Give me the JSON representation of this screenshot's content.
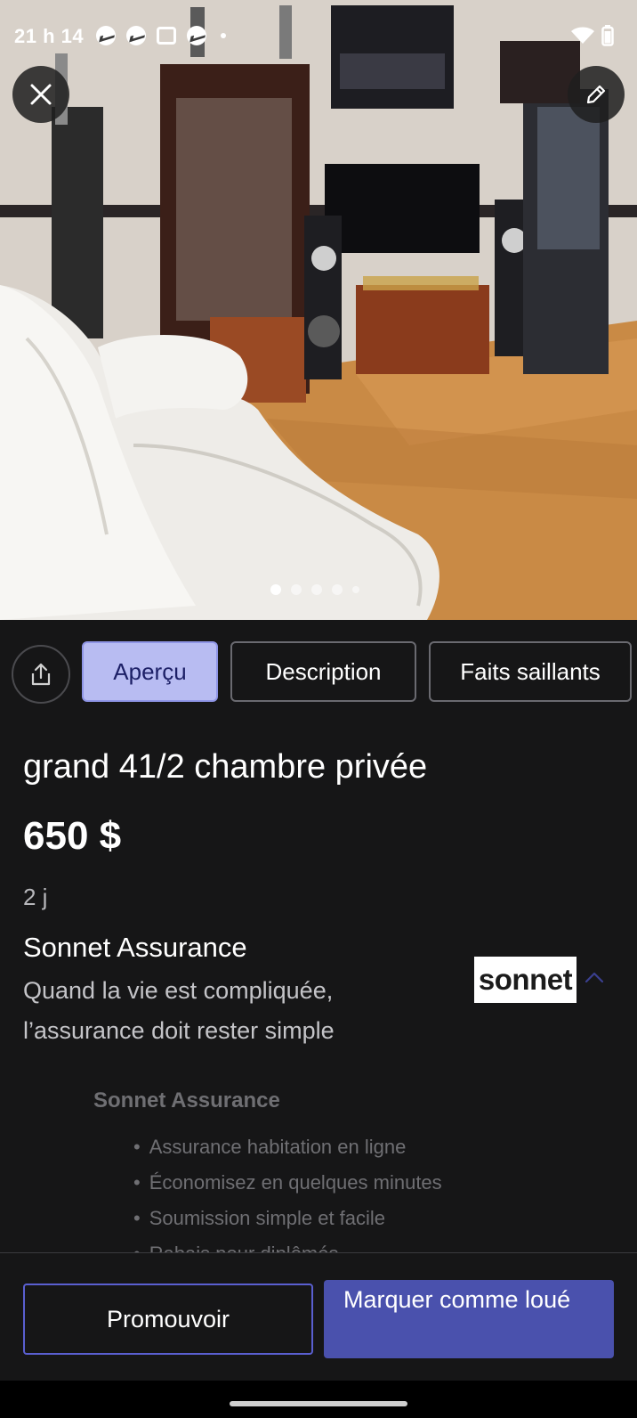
{
  "status_bar": {
    "time": "21 h 14",
    "icons": [
      "messenger-icon",
      "messenger-icon",
      "notification-icon",
      "messenger-icon",
      "dot-icon",
      "wifi-icon",
      "battery-icon"
    ]
  },
  "photo": {
    "current_index": 1,
    "total": 5
  },
  "tabs": [
    {
      "label": "Aperçu",
      "selected": true
    },
    {
      "label": "Description",
      "selected": false
    },
    {
      "label": "Faits saillants",
      "selected": false
    }
  ],
  "listing": {
    "title": "grand 41/2 chambre privée",
    "price": "650 $",
    "age": "2 j"
  },
  "ad": {
    "title": "Sonnet Assurance",
    "line1": "Quand la vie est compliquée,",
    "line2": "l’assurance doit rester simple",
    "logo_text": "sonnet",
    "sub_title": "Sonnet Assurance",
    "bullets": [
      "Assurance habitation en ligne",
      "Économisez en quelques minutes",
      "Soumission simple et facile",
      "Rabais pour diplômés"
    ]
  },
  "actions": {
    "promote_label": "Promouvoir",
    "rented_label": "Marquer comme loué"
  },
  "colors": {
    "background": "#161617",
    "tab_selected_bg": "#b8bcf2",
    "tab_selected_text": "#1c1f66",
    "primary_button": "#4a51ad",
    "promote_border": "#5a5fd0"
  }
}
